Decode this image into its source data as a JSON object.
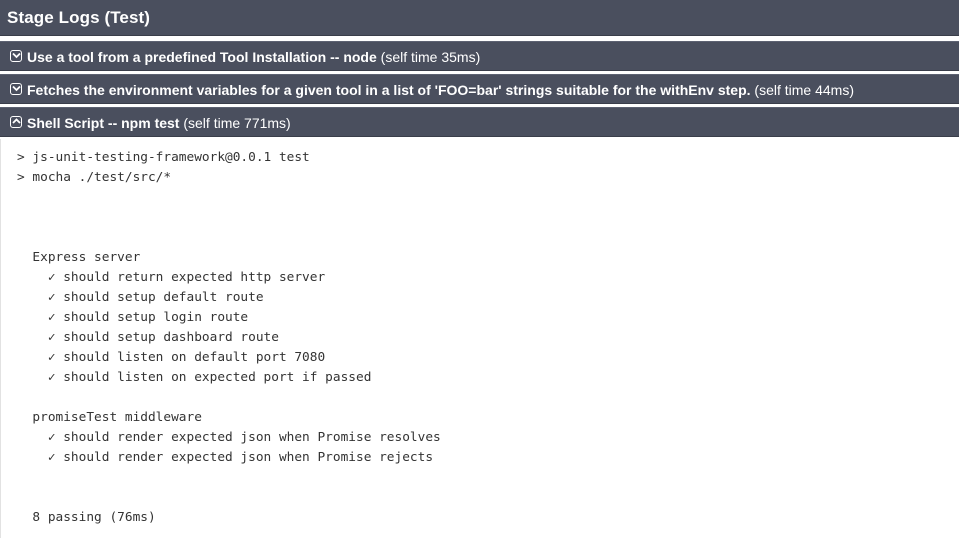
{
  "header": {
    "title": "Stage Logs (Test)"
  },
  "steps": [
    {
      "name": "Use a tool from a predefined Tool Installation -- node",
      "time": "(self time 35ms)",
      "expanded": false
    },
    {
      "name": "Fetches the environment variables for a given tool in a list of 'FOO=bar' strings suitable for the withEnv step.",
      "time": "(self time 44ms)",
      "expanded": false
    },
    {
      "name": "Shell Script -- npm test",
      "time": "(self time 771ms)",
      "expanded": true
    }
  ],
  "log": {
    "lines": [
      "> js-unit-testing-framework@0.0.1 test",
      "> mocha ./test/src/*",
      "",
      "",
      "",
      "  Express server",
      "    ✓ should return expected http server",
      "    ✓ should setup default route",
      "    ✓ should setup login route",
      "    ✓ should setup dashboard route",
      "    ✓ should listen on default port 7080",
      "    ✓ should listen on expected port if passed",
      "",
      "  promiseTest middleware",
      "    ✓ should render expected json when Promise resolves",
      "    ✓ should render expected json when Promise rejects",
      "",
      "",
      "  8 passing (76ms)"
    ]
  },
  "colors": {
    "header_bg": "#4a4f5e",
    "header_text": "#ffffff",
    "log_text": "#333333"
  },
  "icons": {
    "collapsed": "expand-circle-icon",
    "expanded": "collapse-circle-icon"
  }
}
